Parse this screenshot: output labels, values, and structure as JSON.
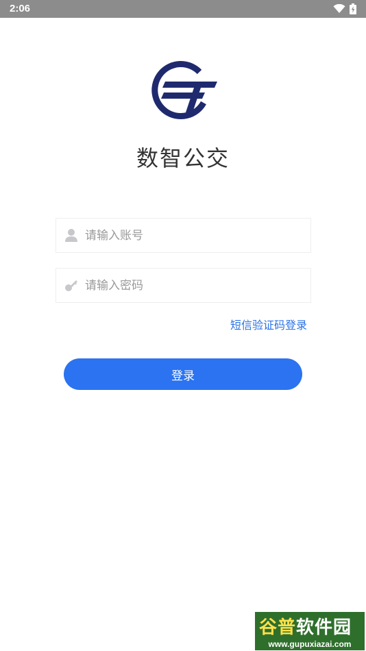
{
  "status_bar": {
    "time": "2:06"
  },
  "app": {
    "title": "数智公交"
  },
  "form": {
    "account_placeholder": "请输入账号",
    "password_placeholder": "请输入密码",
    "sms_login_label": "短信验证码登录",
    "login_label": "登录"
  },
  "icons": {
    "account": "user-icon",
    "password": "key-icon",
    "wifi": "wifi-icon",
    "battery": "battery-icon"
  },
  "colors": {
    "primary": "#2b73f0",
    "link": "#2a72e6",
    "logo": "#1f2a6e",
    "status_bar": "#8c8c8c"
  },
  "watermark": {
    "title_part1": "谷普",
    "title_part2": "软件园",
    "url": "www.gupuxiazai.com"
  }
}
